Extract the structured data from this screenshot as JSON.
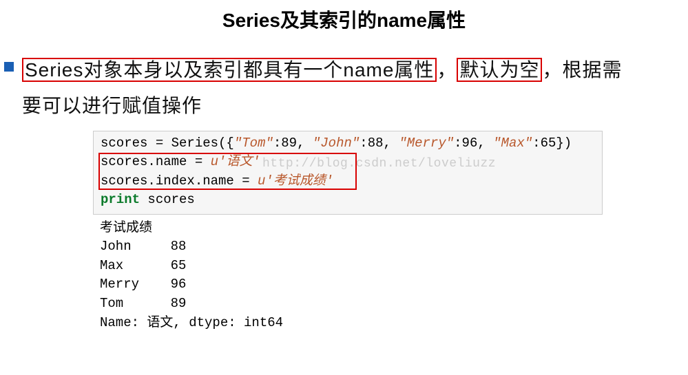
{
  "title": "Series及其索引的name属性",
  "description": {
    "part1_boxed": "Series对象本身以及索引都具有一个name属性",
    "comma1": "，",
    "part2_boxed": "默认为空",
    "comma2": "，",
    "part3": "根据需",
    "part4": "要可以进行赋值操作"
  },
  "code": {
    "line1_pre": "scores = Series({",
    "line1_k1": "\"Tom\"",
    "line1_v1": ":89, ",
    "line1_k2": "\"John\"",
    "line1_v2": ":88, ",
    "line1_k3": "\"Merry\"",
    "line1_v3": ":96, ",
    "line1_k4": "\"Max\"",
    "line1_v4": ":65})",
    "line2_pre": "scores.name = ",
    "line2_str": "u'语文'",
    "line3_pre": "scores.index.name = ",
    "line3_str": "u'考试成绩'",
    "line4_kw": "print",
    "line4_rest": " scores",
    "watermark": "http://blog.csdn.net/loveliuzz"
  },
  "output": {
    "l1": "考试成绩",
    "l2": "John     88",
    "l3": "Max      65",
    "l4": "Merry    96",
    "l5": "Tom      89",
    "l6": "Name: 语文, dtype: int64"
  }
}
